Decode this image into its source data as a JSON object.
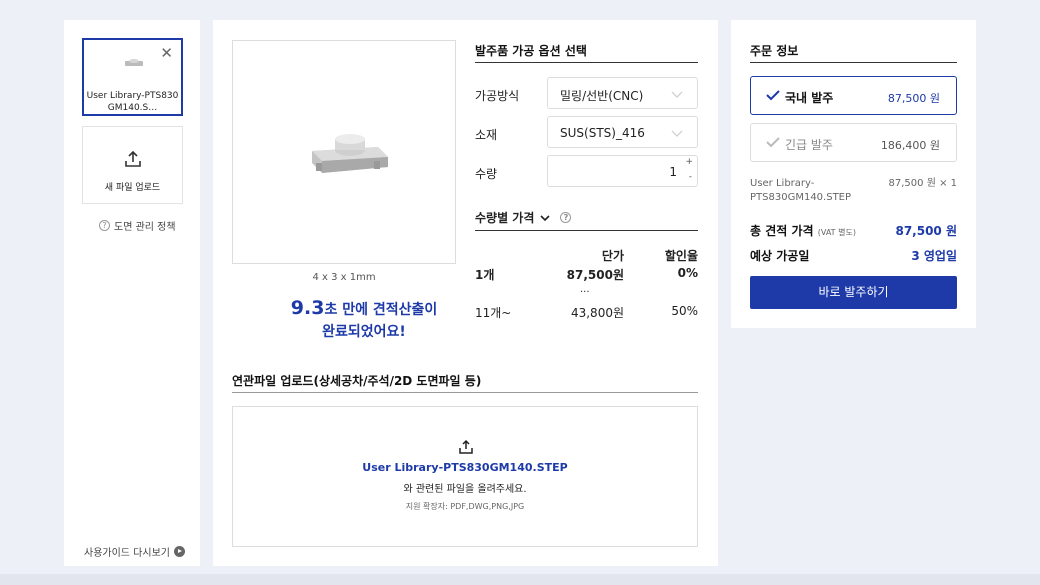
{
  "sidebar": {
    "file_name": "User Library-PTS830GM140.S…",
    "new_upload_label": "새 파일 업로드",
    "policy_label": "도면 관리 정책",
    "guide_label": "사용가이드 다시보기"
  },
  "preview": {
    "dimensions": "4 x 3 x 1mm",
    "time_value": "9.3",
    "time_text": "초 만에 견적산출이",
    "time_text2": "완료되었어요!"
  },
  "options": {
    "title": "발주품 가공 옵션 선택",
    "method_label": "가공방식",
    "method_value": "밀링/선반(CNC)",
    "material_label": "소재",
    "material_value": "SUS(STS)_416",
    "quantity_label": "수량",
    "quantity_value": "1",
    "plus": "+",
    "minus": "-"
  },
  "price_table": {
    "title": "수량별 가격",
    "help": "?",
    "col_unit": "단가",
    "col_discount": "할인율",
    "rows": [
      {
        "qty": "1개",
        "price": "87,500원",
        "discount": "0%"
      },
      {
        "qty": "11개~",
        "price": "43,800원",
        "discount": "50%"
      }
    ],
    "ellipsis": "..."
  },
  "related_upload": {
    "title": "연관파일 업로드(상세공차/주석/2D 도면파일 등)",
    "file_name": "User Library-PTS830GM140.STEP",
    "message": "와 관련된 파일을 올려주세요.",
    "extensions": "지원 확장자: PDF,DWG,PNG,JPG"
  },
  "order": {
    "title": "주문 정보",
    "domestic_label": "국내 발주",
    "domestic_price": "87,500 원",
    "urgent_label": "긴급 발주",
    "urgent_price": "186,400 원",
    "item_name": "User Library-PTS830GM140.STEP",
    "item_price": "87,500 원 × 1",
    "total_label": "총 견적 가격",
    "total_note": "(VAT 별도)",
    "total_value": "87,500 원",
    "days_label": "예상 가공일",
    "days_value": "3 영업일",
    "cta_label": "바로 발주하기"
  }
}
